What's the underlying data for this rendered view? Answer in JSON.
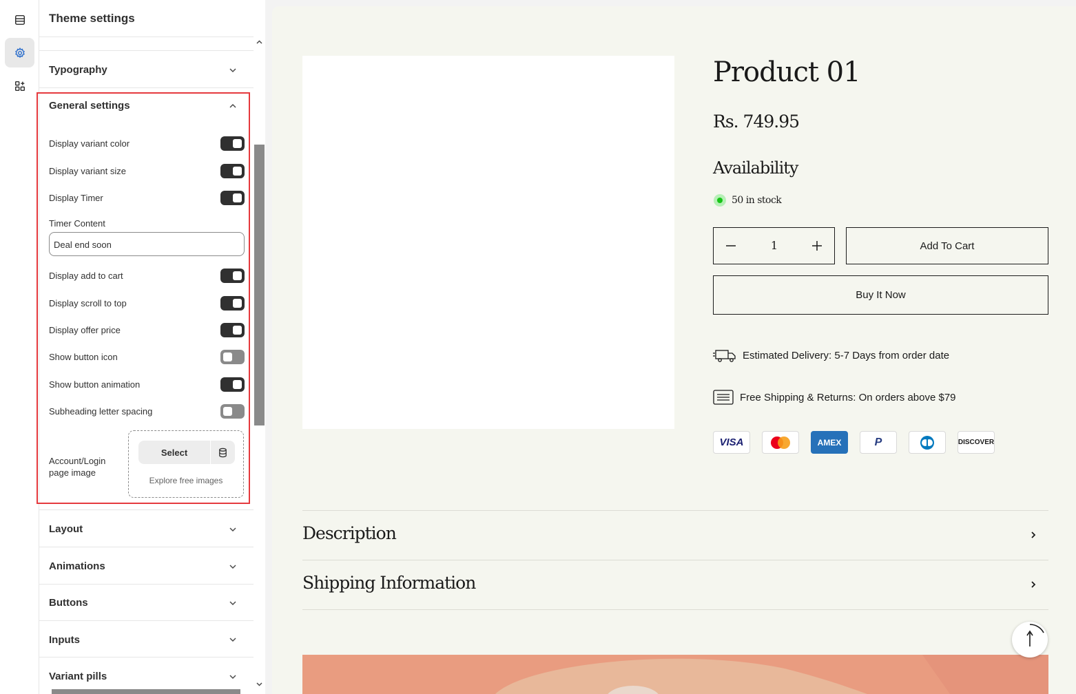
{
  "app": {
    "rail": [
      {
        "name": "sections-icon"
      },
      {
        "name": "theme-settings-icon",
        "active": true
      },
      {
        "name": "apps-icon"
      }
    ]
  },
  "panel": {
    "title": "Theme settings",
    "sections_before": [
      {
        "label": "Typography"
      }
    ],
    "general": {
      "label": "General settings",
      "toggles": [
        {
          "label": "Display variant color",
          "on": true
        },
        {
          "label": "Display variant size",
          "on": true
        },
        {
          "label": "Display Timer",
          "on": true
        }
      ],
      "timer_content_label": "Timer Content",
      "timer_content_value": "Deal end soon",
      "toggles2": [
        {
          "label": "Display add to cart",
          "on": true
        },
        {
          "label": "Display scroll to top",
          "on": true
        },
        {
          "label": "Display offer price",
          "on": true
        },
        {
          "label": "Show button icon",
          "on": false
        },
        {
          "label": "Show button animation",
          "on": true
        },
        {
          "label": "Subheading letter spacing",
          "on": false
        }
      ],
      "account_image_label_line1": "Account/Login",
      "account_image_label_line2": "page image",
      "select_label": "Select",
      "explore_label": "Explore free images"
    },
    "sections_after": [
      {
        "label": "Layout"
      },
      {
        "label": "Animations"
      },
      {
        "label": "Buttons"
      },
      {
        "label": "Inputs"
      },
      {
        "label": "Variant pills"
      }
    ]
  },
  "preview": {
    "title": "Product 01",
    "price": "Rs. 749.95",
    "availability_label": "Availability",
    "stock_text": "50 in stock",
    "quantity": "1",
    "add_to_cart": "Add To Cart",
    "buy_now": "Buy It Now",
    "delivery_text": "Estimated Delivery: 5-7 Days from order date",
    "shipping_text": "Free Shipping & Returns: On orders above $79",
    "payment_methods": [
      "VISA",
      "Mastercard",
      "AMEX",
      "PayPal",
      "Diners",
      "DISCOVER"
    ],
    "accordions": [
      {
        "label": "Description"
      },
      {
        "label": "Shipping Information"
      }
    ],
    "colors": {
      "stock_green": "#18c418",
      "banner": "#e99c80",
      "highlight": "#e5393d"
    }
  }
}
